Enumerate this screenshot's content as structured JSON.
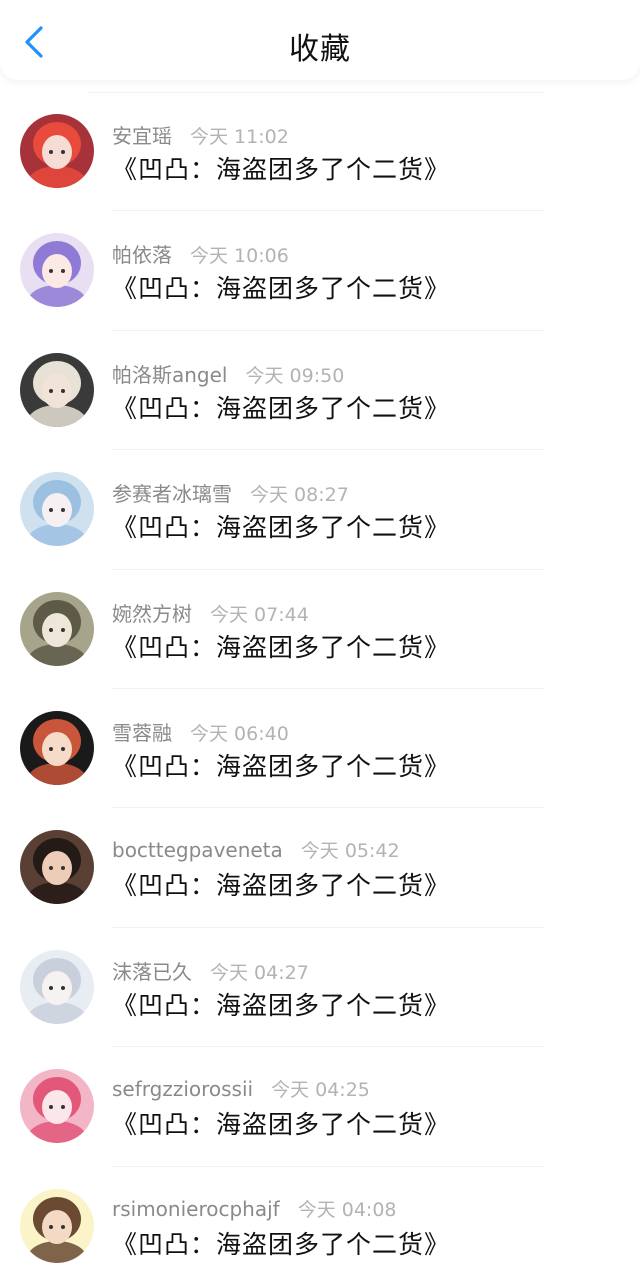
{
  "header": {
    "title": "收藏",
    "back_icon": "chevron-left-icon",
    "accent": "#1E90FF"
  },
  "items": [
    {
      "name": "安宜瑶",
      "time": "今天 11:02",
      "message": "《凹凸：海盗团多了个二货》",
      "avatar_bg": "#a8323a",
      "avatar_fg": "#e84a3c",
      "avatar_skin": "#f5dcd4"
    },
    {
      "name": "帕依落",
      "time": "今天 10:06",
      "message": "《凹凸：海盗团多了个二货》",
      "avatar_bg": "#e9dff2",
      "avatar_fg": "#8f7ad6",
      "avatar_skin": "#fbe9e6"
    },
    {
      "name": "帕洛斯angel",
      "time": "今天 09:50",
      "message": "《凹凸：海盗团多了个二货》",
      "avatar_bg": "#3a3a3a",
      "avatar_fg": "#e8e2d6",
      "avatar_skin": "#f2e3d8"
    },
    {
      "name": "参赛者冰璃雪",
      "time": "今天 08:27",
      "message": "《凹凸：海盗团多了个二货》",
      "avatar_bg": "#cfe1ef",
      "avatar_fg": "#9cc0e0",
      "avatar_skin": "#f6f0f2"
    },
    {
      "name": "婉然方树",
      "time": "今天 07:44",
      "message": "《凹凸：海盗团多了个二货》",
      "avatar_bg": "#a7a48c",
      "avatar_fg": "#5d5a48",
      "avatar_skin": "#efe6da"
    },
    {
      "name": "雪蓉融",
      "time": "今天 06:40",
      "message": "《凹凸：海盗团多了个二货》",
      "avatar_bg": "#1a1a1a",
      "avatar_fg": "#c9553a",
      "avatar_skin": "#f6dcc8"
    },
    {
      "name": "bocttegpaveneta",
      "time": "今天 05:42",
      "message": "《凹凸：海盗团多了个二货》",
      "avatar_bg": "#5a4034",
      "avatar_fg": "#241a16",
      "avatar_skin": "#eecdb8"
    },
    {
      "name": "沫落已久",
      "time": "今天 04:27",
      "message": "《凹凸：海盗团多了个二货》",
      "avatar_bg": "#e8ecf3",
      "avatar_fg": "#c9d0dc",
      "avatar_skin": "#f7f2f2"
    },
    {
      "name": "sefrgzziorossii",
      "time": "今天 04:25",
      "message": "《凹凸：海盗团多了个二货》",
      "avatar_bg": "#f2b6c6",
      "avatar_fg": "#e2577a",
      "avatar_skin": "#fbe7ea"
    },
    {
      "name": "rsimonierocphajf",
      "time": "今天 04:08",
      "message": "《凹凸：海盗团多了个二货》",
      "avatar_bg": "#faf4c8",
      "avatar_fg": "#6a4a32",
      "avatar_skin": "#f4d9c4"
    }
  ]
}
